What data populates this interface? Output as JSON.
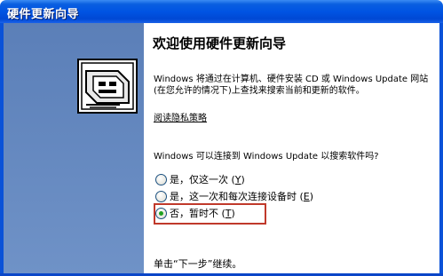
{
  "window": {
    "title": "硬件更新向导"
  },
  "wizard": {
    "heading": "欢迎使用硬件更新向导",
    "description": "Windows 将通过在计算机、硬件安装 CD 或 Windows Update 网站(在您允许的情况下)上查找来搜索当前和更新的软件。",
    "privacy_link": "阅读隐私策略",
    "question": "Windows 可以连接到 Windows Update 以搜索软件吗?",
    "options": [
      {
        "label": "是，仅这一次",
        "mnemonic": "Y",
        "selected": false
      },
      {
        "label": "是，这一次和每次连接设备时",
        "mnemonic": "E",
        "selected": false
      },
      {
        "label": "否，暂时不",
        "mnemonic": "T",
        "selected": true
      }
    ],
    "footer": "单击“下一步”继续。"
  },
  "colors": {
    "titlebar": "#0054e3",
    "sidebar": "#6f92c7",
    "highlight_box": "#c0392b",
    "radio_selected": "#21a121"
  },
  "icons": {
    "wizard_graphic": "hardware-card-icon"
  }
}
